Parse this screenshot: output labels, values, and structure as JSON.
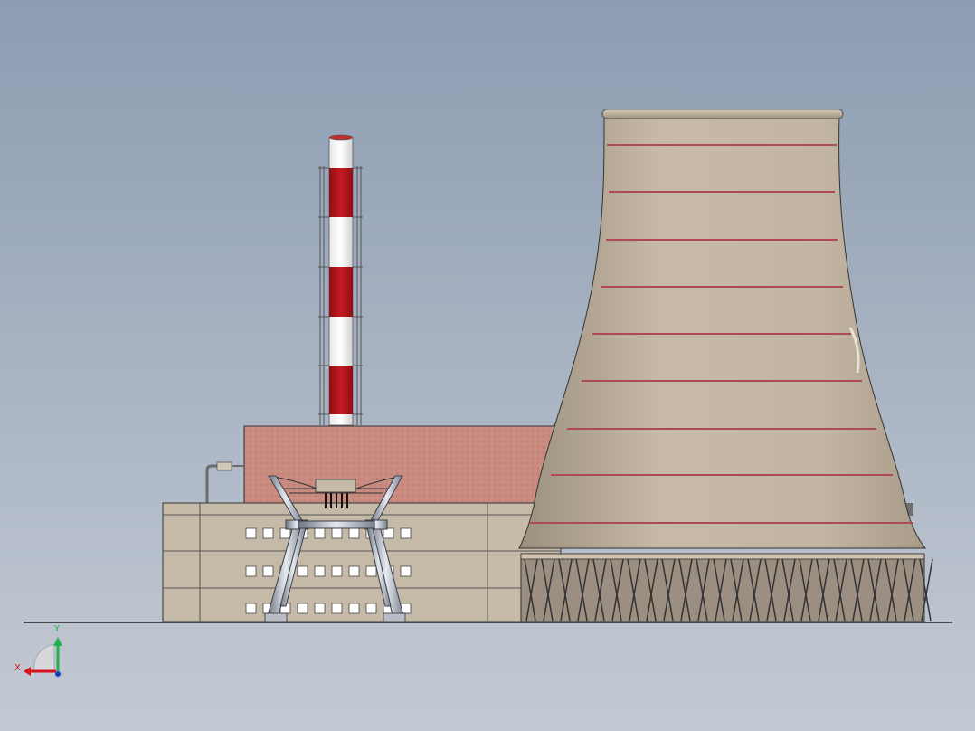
{
  "colors": {
    "background_top": "#8c9cb1",
    "background_bottom": "#c4cad4",
    "ground_line": "#1f1f1f",
    "chimney_red": "#b8161d",
    "chimney_white": "#f2f2f2",
    "brick_wall": "#c98a80",
    "concrete": "#c5b9a7",
    "tower_concrete": "#bfb09b",
    "tower_stripe": "#b04a52",
    "steel_frame": "#aeb6c3",
    "axis_x": "#d4141a",
    "axis_y": "#22b14c",
    "axis_z": "#1a3cc8"
  },
  "scene": {
    "objects": [
      "chimney-stack",
      "turbine-hall",
      "office-block",
      "crane-frame",
      "cooling-tower"
    ]
  },
  "triad": {
    "x_label": "X",
    "y_label": "Y"
  }
}
